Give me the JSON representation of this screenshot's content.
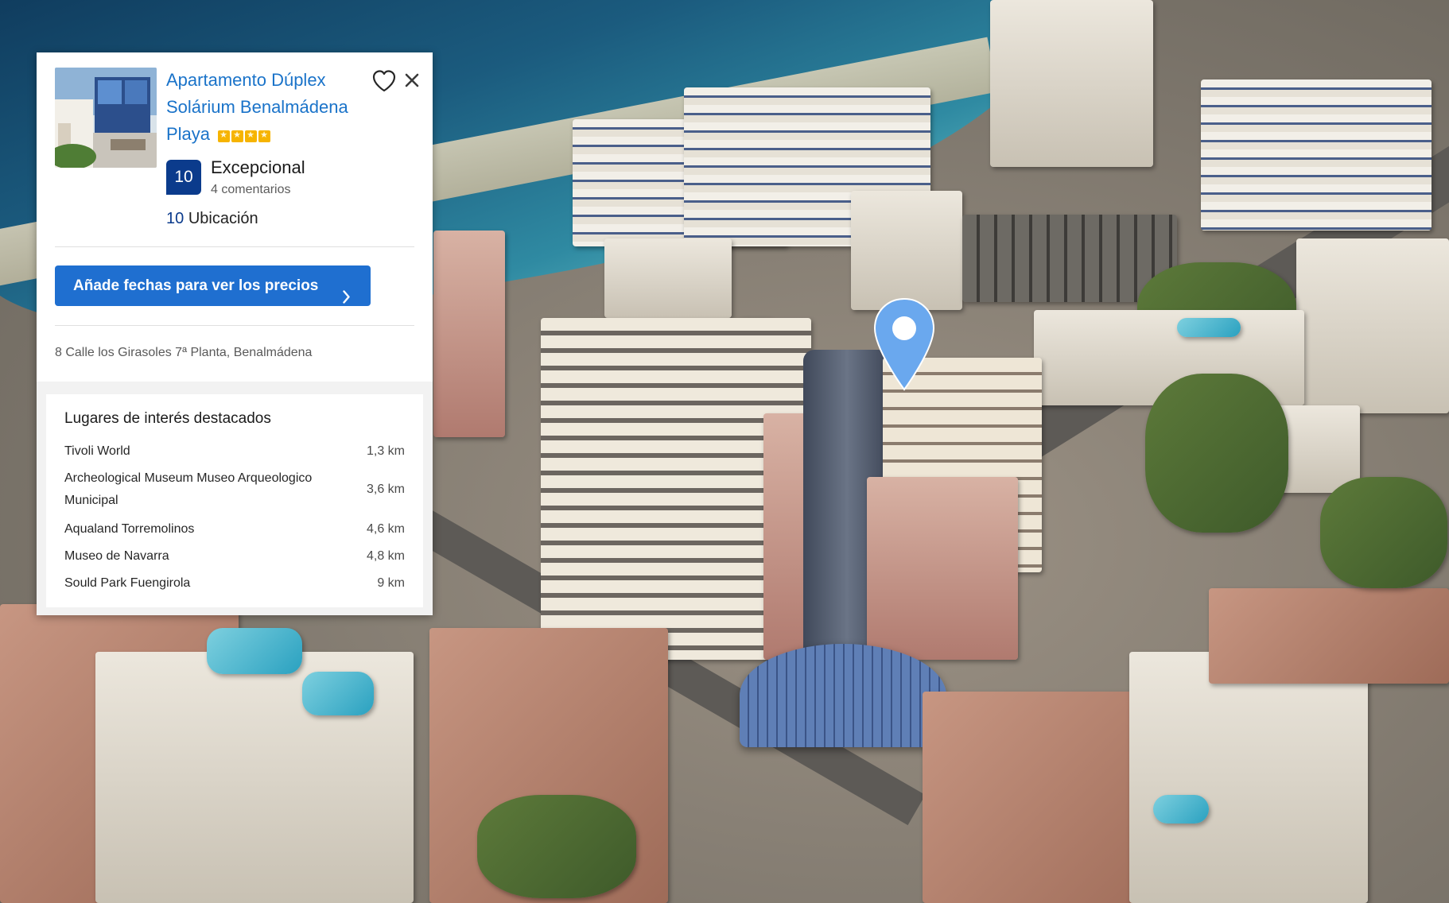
{
  "listing": {
    "title": "Apartamento Dúplex Solárium Benalmádena Playa",
    "star_rating": 4,
    "score": "10",
    "score_word": "Excepcional",
    "review_count": "4 comentarios",
    "location_score": "10",
    "location_label": "Ubicación",
    "cta_label": "Añade fechas para ver los precios",
    "address": "8 Calle los Girasoles 7ª Planta, Benalmádena"
  },
  "poi": {
    "title": "Lugares de interés destacados",
    "items": [
      {
        "name": "Tivoli World",
        "distance": "1,3 km"
      },
      {
        "name": "Archeological Museum Museo Arqueologico Municipal",
        "distance": "3,6 km"
      },
      {
        "name": "Aqualand Torremolinos",
        "distance": "4,6 km"
      },
      {
        "name": "Museo de Navarra",
        "distance": "4,8 km"
      },
      {
        "name": "Sould Park Fuengirola",
        "distance": "9 km"
      }
    ]
  },
  "icons": {
    "favorite": "heart-icon",
    "close": "close-icon",
    "cta_arrow": "chevron-right-icon",
    "map_pin": "map-pin-icon"
  },
  "colors": {
    "title_link": "#1a73c9",
    "score_badge": "#0b3b8c",
    "cta_button": "#1f6fd0",
    "stars": "#f6b400",
    "pin": "#6aa8ee"
  }
}
